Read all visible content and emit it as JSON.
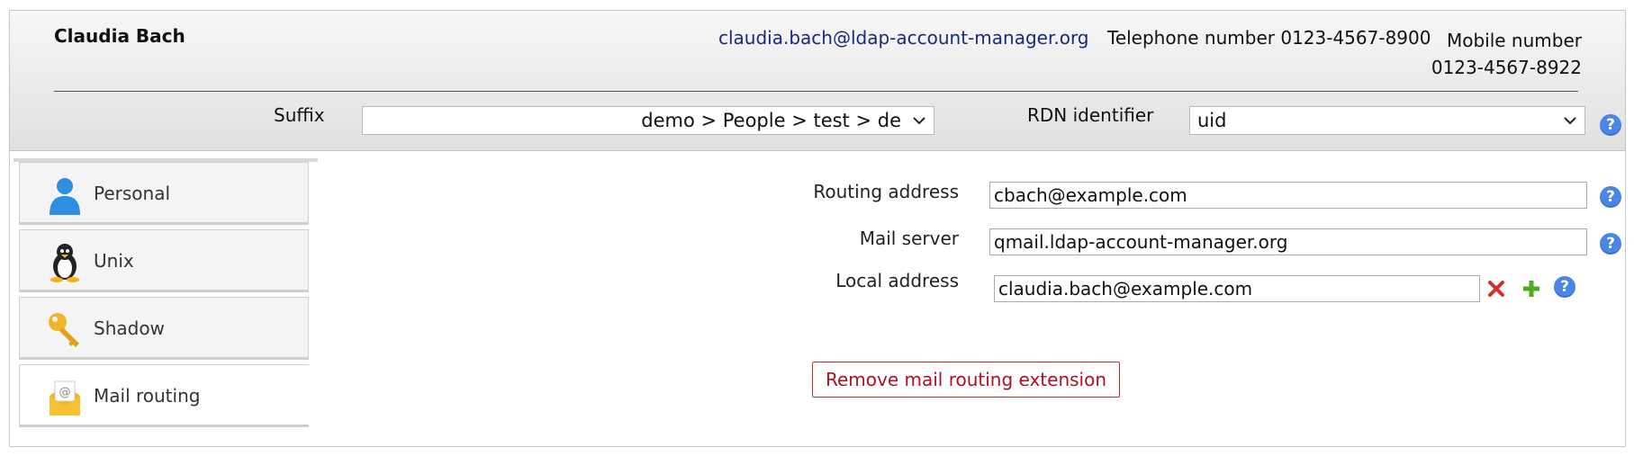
{
  "header": {
    "user_name": "Claudia Bach",
    "email": "claudia.bach@ldap-account-manager.org",
    "telephone": "Telephone number 0123-4567-8900",
    "mobile": "Mobile number 0123-4567-8922",
    "suffix_label": "Suffix",
    "suffix_value": "demo > People > test > de",
    "rdn_label": "RDN identifier",
    "rdn_value": "uid",
    "help_glyph": "?"
  },
  "tabs": [
    {
      "label": "Personal",
      "icon": "person-icon",
      "active": false
    },
    {
      "label": "Unix",
      "icon": "penguin-icon",
      "active": false
    },
    {
      "label": "Shadow",
      "icon": "key-icon",
      "active": false
    },
    {
      "label": "Mail routing",
      "icon": "mail-envelope-icon",
      "active": true
    }
  ],
  "form": {
    "routing_address_label": "Routing address",
    "routing_address_value": "cbach@example.com",
    "mail_server_label": "Mail server",
    "mail_server_value": "qmail.ldap-account-manager.org",
    "local_address_label": "Local address",
    "local_address_value": "claudia.bach@example.com",
    "remove_button_label": "Remove mail routing extension"
  },
  "colors": {
    "help_icon": "#4a86e8",
    "delete_icon": "#d03030",
    "add_icon": "#4caf1a",
    "remove_button_text": "#b01020",
    "email_link": "#1a2a7a"
  }
}
